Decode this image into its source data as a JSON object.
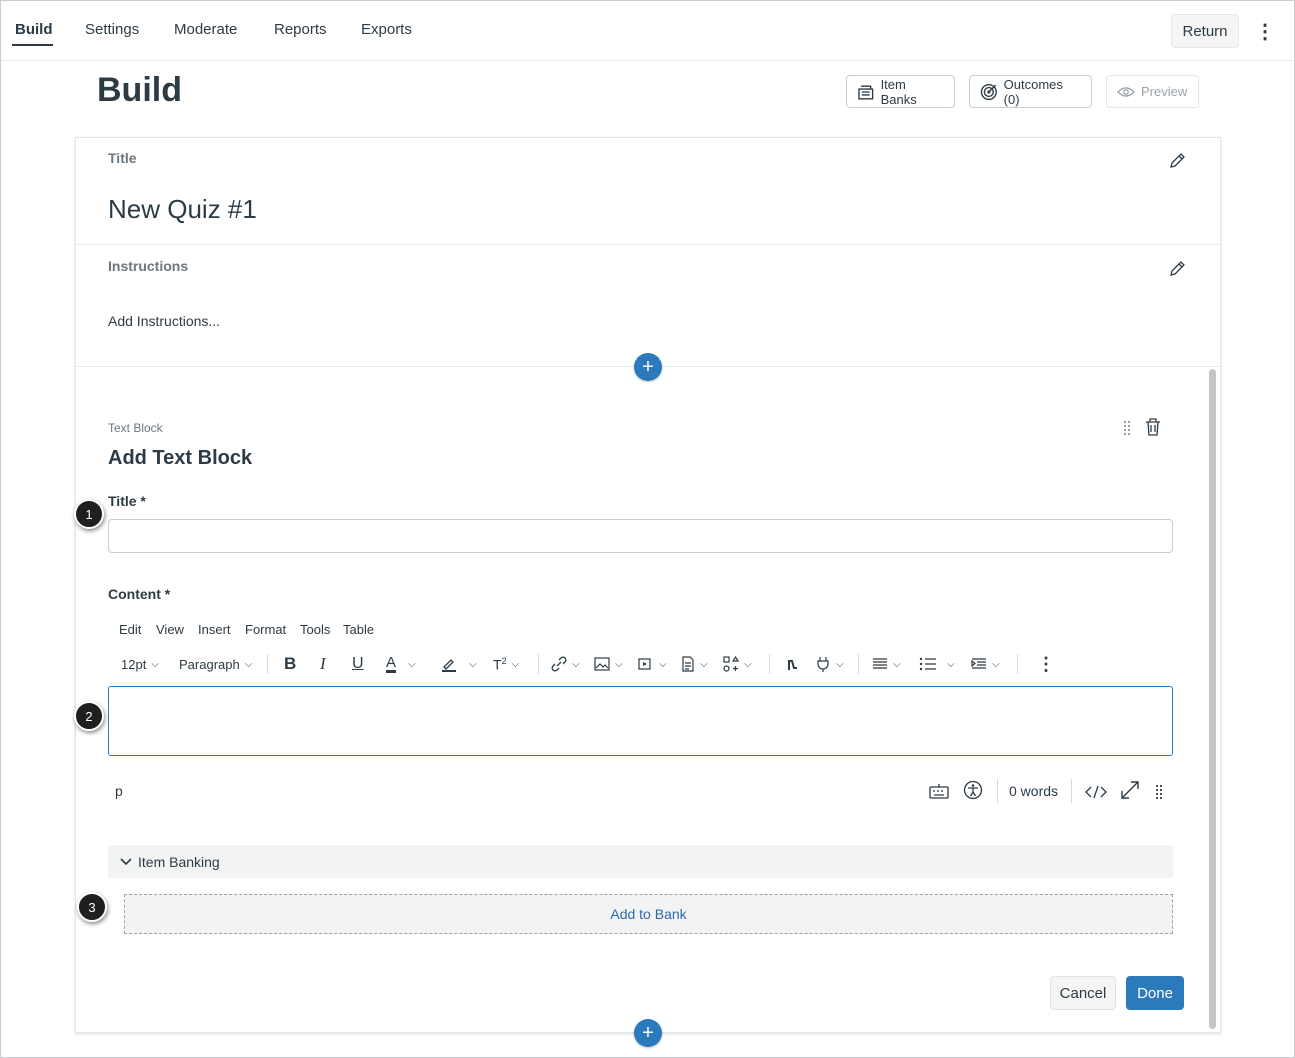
{
  "nav": {
    "tabs": [
      {
        "label": "Build"
      },
      {
        "label": "Settings"
      },
      {
        "label": "Moderate"
      },
      {
        "label": "Reports"
      },
      {
        "label": "Exports"
      }
    ],
    "return_label": "Return"
  },
  "page": {
    "title": "Build",
    "item_banks_label": "Item Banks",
    "outcomes_label": "Outcomes (0)",
    "preview_label": "Preview"
  },
  "quiz": {
    "title_label": "Title",
    "title_value": "New Quiz #1",
    "instructions_label": "Instructions",
    "instructions_placeholder": "Add Instructions..."
  },
  "text_block": {
    "type_label": "Text Block",
    "heading": "Add Text Block",
    "title_field_label": "Title *",
    "title_value": "",
    "content_field_label": "Content *"
  },
  "editor": {
    "menubar": [
      "Edit",
      "View",
      "Insert",
      "Format",
      "Tools",
      "Table"
    ],
    "font_size": "12pt",
    "block_format": "Paragraph",
    "path": "p",
    "word_count": "0 words"
  },
  "item_banking": {
    "label": "Item Banking",
    "add_to_bank": "Add to Bank"
  },
  "actions": {
    "cancel": "Cancel",
    "done": "Done"
  },
  "callouts": [
    "1",
    "2",
    "3"
  ],
  "colors": {
    "accent": "#2b7abc",
    "text": "#2d3b45",
    "muted": "#6b7780"
  }
}
